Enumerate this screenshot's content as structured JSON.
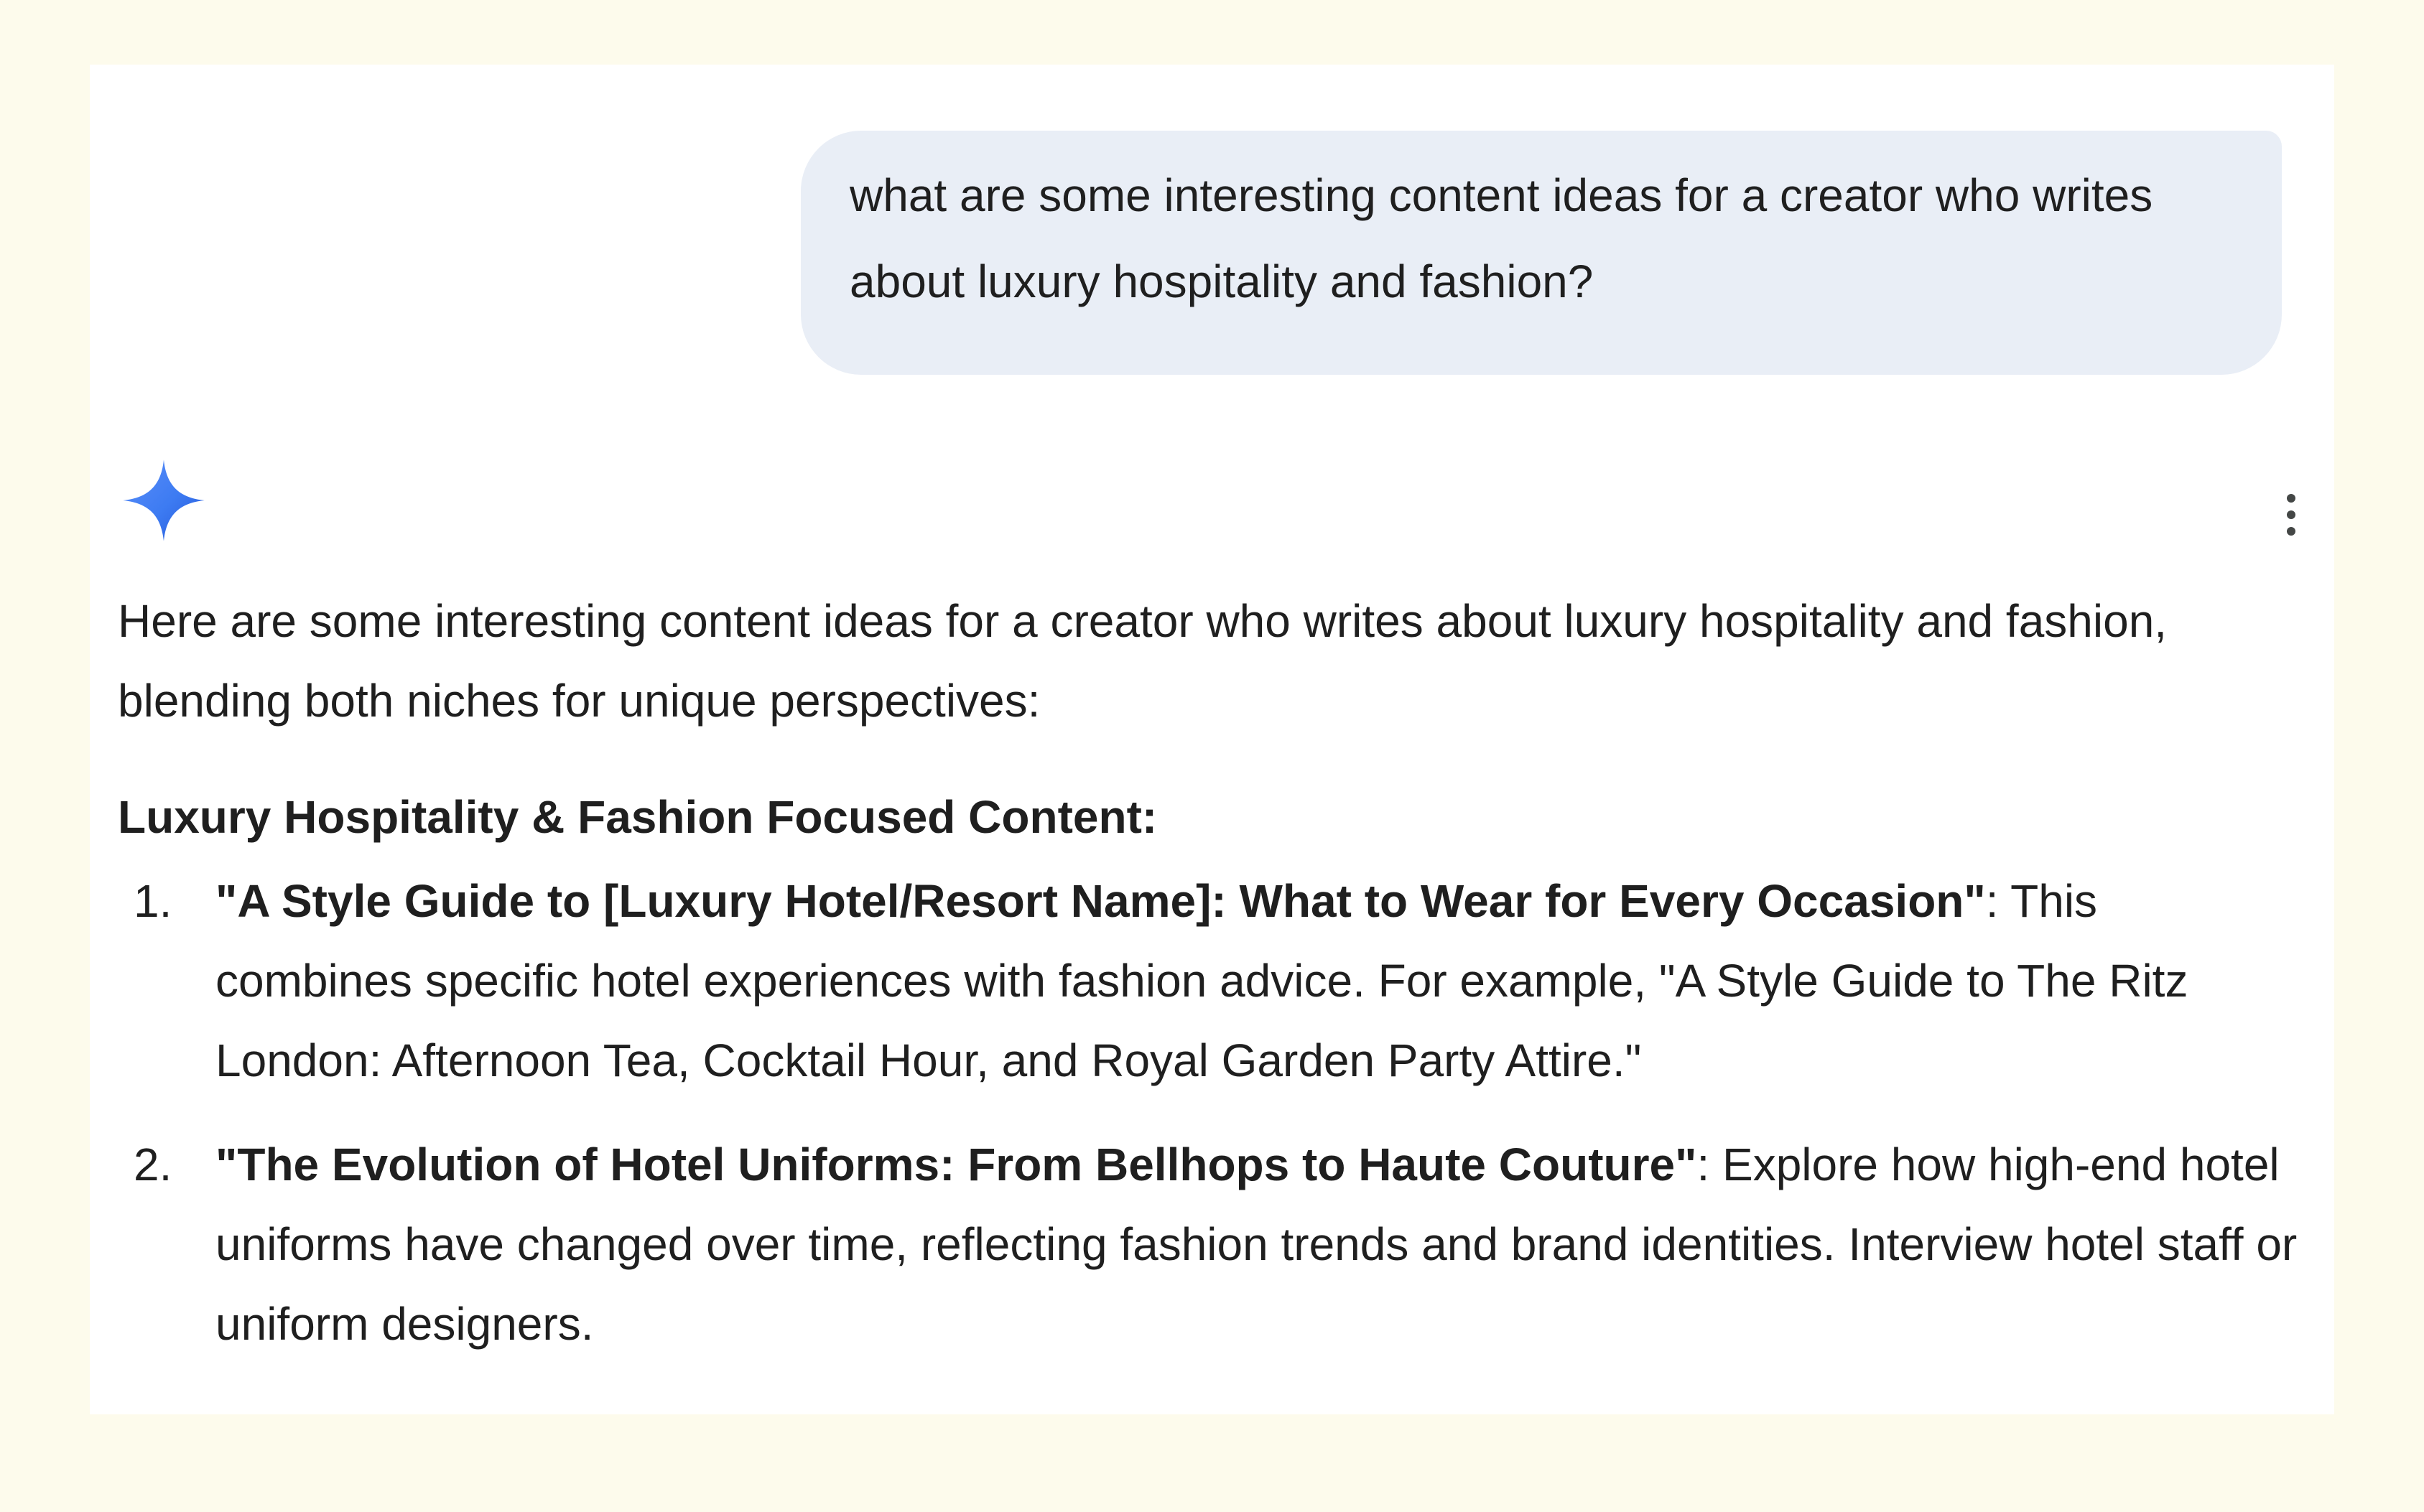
{
  "user_prompt": {
    "text": "what are some interesting content ideas for a creator who writes about luxury hospitality and fashion?"
  },
  "response": {
    "icon": "gemini-sparkle-icon",
    "menu_icon": "more-vertical-icon",
    "intro": "Here are some interesting content ideas for a creator who writes about luxury hospitality and fashion, blending both niches for unique perspectives:",
    "section_heading": "Luxury Hospitality & Fashion Focused Content:",
    "items": [
      {
        "number": "1.",
        "title": "\"A Style Guide to [Luxury Hotel/Resort Name]: What to Wear for Every Occasion\"",
        "body": ": This combines specific hotel experiences with fashion advice. For example, \"A Style Guide to The Ritz London: Afternoon Tea, Cocktail Hour, and Royal Garden Party Attire.\""
      },
      {
        "number": "2.",
        "title": "\"The Evolution of Hotel Uniforms: From Bellhops to Haute Couture\"",
        "body": ": Explore how high-end hotel uniforms have changed over time, reflecting fashion trends and brand identities. Interview hotel staff or uniform designers."
      }
    ]
  },
  "colors": {
    "page_background": "#fdfbec",
    "card_background": "#ffffff",
    "user_bubble": "#e9eef6",
    "text": "#1f1f1f",
    "icon_gray": "#444746",
    "gem_gradient": [
      "#4a8cf7",
      "#2f6ee6"
    ]
  }
}
